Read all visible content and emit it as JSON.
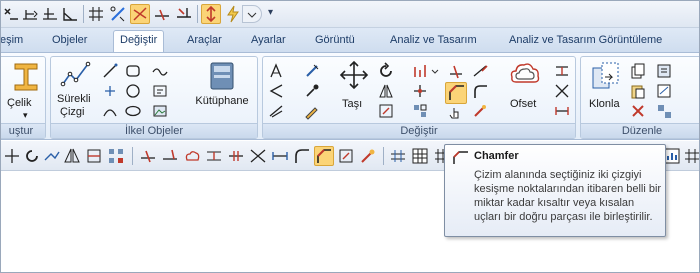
{
  "ribbon_tabs": [
    "eşim",
    "Objeler",
    "Değiştir",
    "Araçlar",
    "Ayarlar",
    "Görüntü",
    "Analiz ve Tasarım",
    "Analiz ve Tasarım Görüntüleme"
  ],
  "qat_more": "▾",
  "groups": {
    "celik": {
      "label": "uştur",
      "button": "Çelik",
      "arrow": "▾"
    },
    "ilkel": {
      "label": "İlkel Objeler",
      "surekli_line1": "Sürekli",
      "surekli_line2": "Çizgi",
      "kutuphane": "Kütüphane"
    },
    "degistir": {
      "label": "Değiştir",
      "tasi": "Taşı",
      "ofset": "Ofset"
    },
    "duzenle": {
      "label": "Düzenle",
      "klonla": "Klonla"
    }
  },
  "tooltip": {
    "title": "Chamfer",
    "body": "Çizim alanında seçtiğiniz iki çizgiyi kesişme noktalarından itibaren belli bir miktar kadar kısaltır veya kısalan uçları bir doğru parçası ile birleştirilir."
  },
  "colors": {
    "accent": "#fbd477",
    "tab_text": "#1e3d68",
    "ribbon_border": "#a9bcd6"
  }
}
